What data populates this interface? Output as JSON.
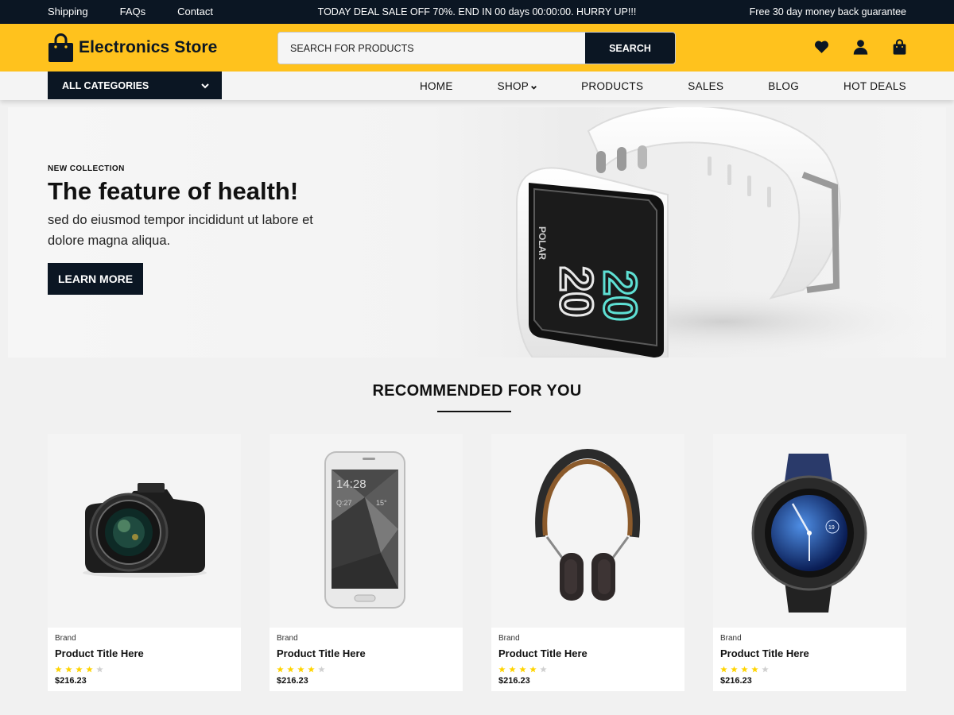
{
  "topbar": {
    "links": [
      "Shipping",
      "FAQs",
      "Contact"
    ],
    "deal": "TODAY DEAL SALE OFF 70%. END IN 00 days 00:00:00. HURRY UP!!!",
    "guarantee": "Free 30 day money back guarantee"
  },
  "header": {
    "store_name": "Electronics Store",
    "search_placeholder": "SEARCH FOR PRODUCTS",
    "search_button": "SEARCH"
  },
  "nav": {
    "all_categories": "ALL CATEGORIES",
    "menu": [
      "HOME",
      "SHOP",
      "PRODUCTS",
      "SALES",
      "BLOG",
      "HOT DEALS"
    ]
  },
  "hero": {
    "kicker": "NEW COLLECTION",
    "title": "The feature of health!",
    "description": "sed do eiusmod tempor incididunt ut labore et dolore magna aliqua.",
    "button": "LEARN MORE",
    "watch_brand": "POLAR",
    "watch_time": [
      "20",
      "20"
    ]
  },
  "recommended": {
    "title": "RECOMMENDED FOR YOU",
    "products": [
      {
        "image": "camera",
        "brand": "Brand",
        "title": "Product Title Here",
        "rating": 4,
        "rating_max": 5,
        "price": "$216.23"
      },
      {
        "image": "smartphone",
        "brand": "Brand",
        "title": "Product Title Here",
        "rating": 4,
        "rating_max": 5,
        "price": "$216.23"
      },
      {
        "image": "headphones",
        "brand": "Brand",
        "title": "Product Title Here",
        "rating": 4,
        "rating_max": 5,
        "price": "$216.23"
      },
      {
        "image": "smartwatch",
        "brand": "Brand",
        "title": "Product Title Here",
        "rating": 4,
        "rating_max": 5,
        "price": "$216.23"
      }
    ]
  },
  "phone_screen": {
    "time": "14:28",
    "date": "Q:27",
    "temp": "15°"
  },
  "watch_face": {
    "number": "19"
  },
  "colors": {
    "accent": "#ffc21d",
    "dark": "#0b1623",
    "star_on": "#ffd400",
    "star_off": "#d0d0d0"
  },
  "icons": [
    "shopping-bag-logo-icon",
    "heart-icon",
    "user-icon",
    "cart-bag-icon",
    "chevron-down-icon",
    "star-icon"
  ]
}
